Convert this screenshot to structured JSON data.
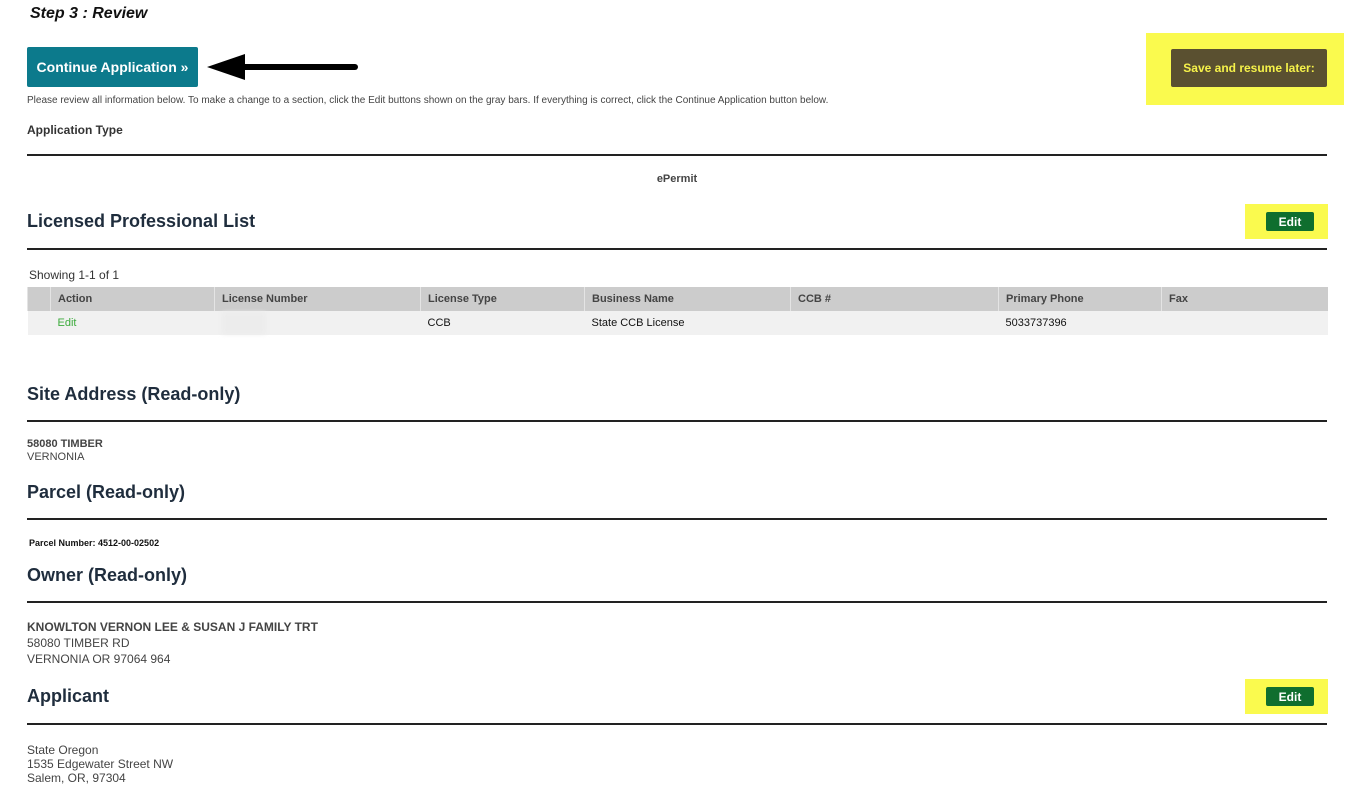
{
  "step": {
    "title": "Step 3 : Review"
  },
  "actions": {
    "continue_label": "Continue Application »",
    "save_label": "Save and resume later:"
  },
  "instructions": "Please review all information below. To make a change to a section, click the Edit buttons shown on the gray bars. If everything is correct, click the Continue Application button below.",
  "application_type": {
    "label": "Application Type",
    "value": "ePermit"
  },
  "licensed_professional": {
    "title": "Licensed Professional List",
    "edit_label": "Edit",
    "showing": "Showing 1-1 of 1",
    "columns": [
      "Action",
      "License Number",
      "License Type",
      "Business Name",
      "CCB #",
      "Primary Phone",
      "Fax"
    ],
    "rows": [
      {
        "action": "Edit",
        "license_number": "",
        "license_type": "CCB",
        "business_name": "State CCB License",
        "ccb": "",
        "primary_phone": "5033737396",
        "fax": ""
      }
    ]
  },
  "site_address": {
    "title": "Site Address (Read-only)",
    "line1": "58080 TIMBER",
    "line2": "VERNONIA"
  },
  "parcel": {
    "title": "Parcel (Read-only)",
    "text": "Parcel Number: 4512-00-02502"
  },
  "owner": {
    "title": "Owner (Read-only)",
    "name": "KNOWLTON VERNON LEE & SUSAN J FAMILY TRT",
    "line1": "58080 TIMBER RD",
    "line2": "VERNONIA OR 97064 964"
  },
  "applicant": {
    "title": "Applicant",
    "edit_label": "Edit",
    "line1": "State Oregon",
    "line2": "1535 Edgewater Street NW",
    "line3": "Salem, OR, 97304"
  },
  "colors": {
    "continue_bg": "#0c7a8c",
    "save_bg": "#5a5030",
    "highlight": "#fafa4e",
    "edit_bg": "#0f6e2e",
    "edit_link": "#3cab3c"
  },
  "icons": {
    "arrow": "arrow-left-icon"
  }
}
